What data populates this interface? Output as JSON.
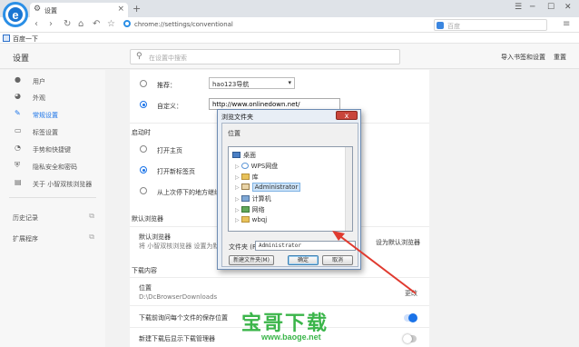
{
  "browser": {
    "logo_letter": "e",
    "tab_title": "设置",
    "tab_close": "×",
    "new_tab": "+",
    "address": "chrome://settings/conventional",
    "search_placeholder": "百度",
    "bookmark": "百度一下",
    "window_controls": [
      "☰",
      "─",
      "☐",
      "✕"
    ]
  },
  "settings": {
    "title": "设置",
    "search_placeholder": "在设置中搜索",
    "import_label": "导入书签和设置",
    "reset_label": "重置"
  },
  "sidebar": {
    "items": [
      {
        "label": "用户",
        "icon": "user-icon"
      },
      {
        "label": "外观",
        "icon": "palette-icon"
      },
      {
        "label": "常规设置",
        "icon": "wrench-icon",
        "active": true
      },
      {
        "label": "标签设置",
        "icon": "tab-icon"
      },
      {
        "label": "手势和快捷键",
        "icon": "gesture-icon"
      },
      {
        "label": "隐私安全和密码",
        "icon": "shield-icon"
      },
      {
        "label": "关于 小智双核浏览器",
        "icon": "info-icon"
      },
      {
        "label": "历史记录",
        "icon": "external-icon"
      },
      {
        "label": "扩展程序",
        "icon": "external-icon"
      }
    ]
  },
  "homepage": {
    "recommend_label": "推荐：",
    "recommend_value": "hao123导航",
    "custom_label": "自定义：",
    "custom_value": "http://www.onlinedown.net/"
  },
  "startup": {
    "header": "启动时",
    "options": [
      "打开主页",
      "打开新标签页",
      "从上次停下的地方继续"
    ]
  },
  "default_browser": {
    "header": "默认浏览器",
    "title": "默认浏览器",
    "desc": "将 小智双核浏览器 设置为默认浏",
    "action": "设为默认浏览器"
  },
  "downloads": {
    "header": "下载内容",
    "location_label": "位置",
    "location_value": "D:\\DcBrowserDownloads",
    "change_label": "更改",
    "ask_label": "下载前询问每个文件的保存位置",
    "show_manager_label": "新建下载后显示下载管理器"
  },
  "dialog": {
    "title": "浏览文件夹",
    "close": "x",
    "location_label": "位置",
    "tree": [
      "桌面",
      "WPS网盘",
      "库",
      "Administrator",
      "计算机",
      "网络",
      "wbqj"
    ],
    "folder_label": "文件夹 (F):",
    "folder_value": "Administrator",
    "new_folder_btn": "新建文件夹(M)",
    "ok_btn": "确定",
    "cancel_btn": "取消"
  },
  "watermark": {
    "big": "宝哥下载",
    "small": "www.baoge.net"
  },
  "colors": {
    "accent": "#1a73e8",
    "arrow": "#e03a2f",
    "watermark": "#3bb54a"
  }
}
